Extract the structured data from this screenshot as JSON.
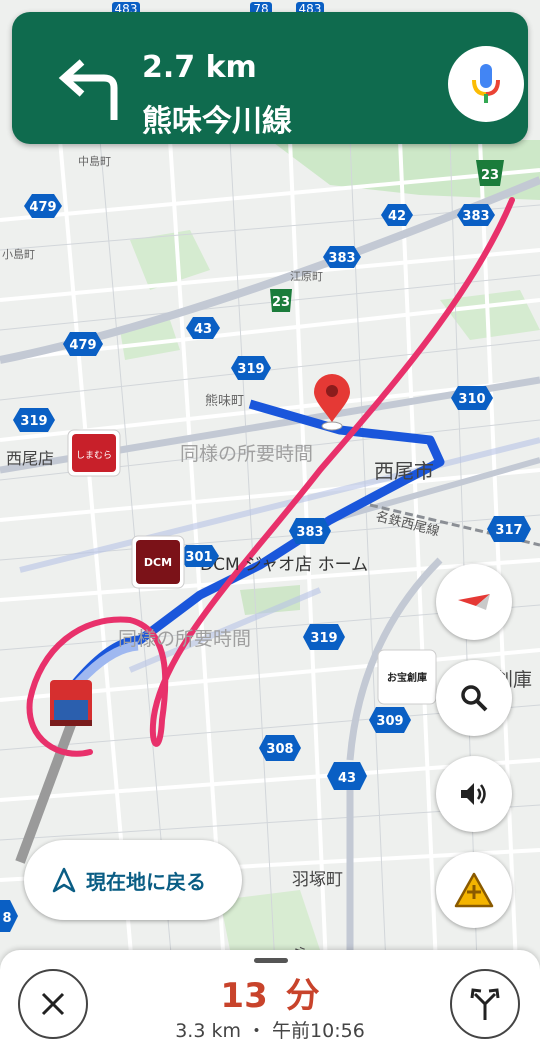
{
  "navigation": {
    "distance": "2.7 km",
    "street": "熊味今川線",
    "turn_icon": "turn-left-icon",
    "mic_icon": "mic-icon"
  },
  "map": {
    "places": [
      "中島町",
      "小島町",
      "江原町",
      "熊味町",
      "西尾店",
      "西尾市",
      "名鉄西尾線",
      "DCM ジャオ店 ホーム",
      "羽塚町",
      "街道",
      "創庫"
    ],
    "route_hints": [
      "同様の所要時間",
      "同様の所要時間"
    ],
    "road_numbers": [
      "483",
      "78",
      "483",
      "23",
      "479",
      "42",
      "383",
      "383",
      "23",
      "43",
      "479",
      "319",
      "310",
      "319",
      "383",
      "317",
      "301",
      "319",
      "309",
      "308",
      "43",
      "8"
    ],
    "logos": [
      "しまむら",
      "DCM",
      "お宝創庫"
    ]
  },
  "controls": {
    "compass_icon": "compass-icon",
    "search_icon": "search-icon",
    "sound_icon": "speaker-icon",
    "report_icon": "report-incident-icon",
    "recenter_label": "現在地に戻る"
  },
  "trip": {
    "eta_minutes": "13",
    "eta_unit": "分",
    "summary": "3.3 km ・ 午前10:56",
    "close_icon": "close-icon",
    "alt_routes_icon": "alternate-routes-icon"
  },
  "colors": {
    "banner": "#0f6b4e",
    "route": "#1a56db",
    "eta": "#c8432b",
    "annotation": "#e8316b"
  }
}
